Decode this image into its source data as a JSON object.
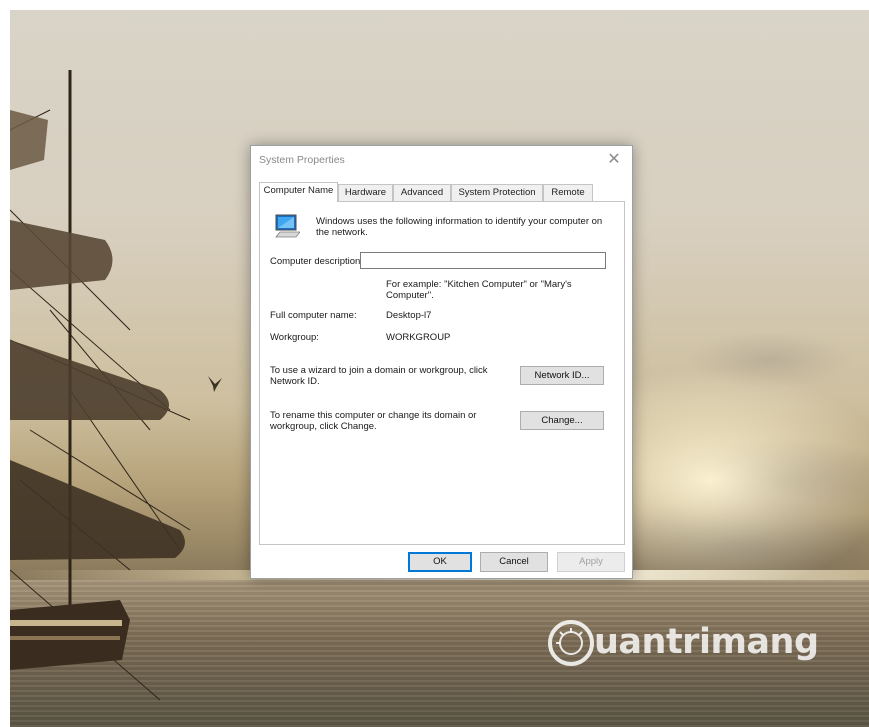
{
  "dialog": {
    "title": "System Properties",
    "close_glyph": "✕",
    "tabs": [
      {
        "label": "Computer Name",
        "active": true
      },
      {
        "label": "Hardware",
        "active": false
      },
      {
        "label": "Advanced",
        "active": false
      },
      {
        "label": "System Protection",
        "active": false
      },
      {
        "label": "Remote",
        "active": false
      }
    ],
    "intro_text": "Windows uses the following information to identify your computer on the network.",
    "computer_description_label": "Computer description:",
    "computer_description_value": "",
    "example_text": "For example: \"Kitchen Computer\" or \"Mary's Computer\".",
    "full_name_label": "Full computer name:",
    "full_name_value": "Desktop-l7",
    "workgroup_label": "Workgroup:",
    "workgroup_value": "WORKGROUP",
    "network_id_text": "To use a wizard to join a domain or workgroup, click Network ID.",
    "network_id_button": "Network ID...",
    "rename_text": "To rename this computer or change its domain or workgroup, click Change.",
    "change_button": "Change...",
    "ok_button": "OK",
    "cancel_button": "Cancel",
    "apply_button": "Apply"
  },
  "icons": {
    "computer": "computer-monitor-icon",
    "close": "close-icon",
    "watermark_logo": "quantrimang-logo"
  },
  "watermark": {
    "text": "uantrimang"
  },
  "colors": {
    "default_button_border": "#0078d7",
    "dialog_background": "#ffffff",
    "title_text": "#8a8a8a"
  }
}
